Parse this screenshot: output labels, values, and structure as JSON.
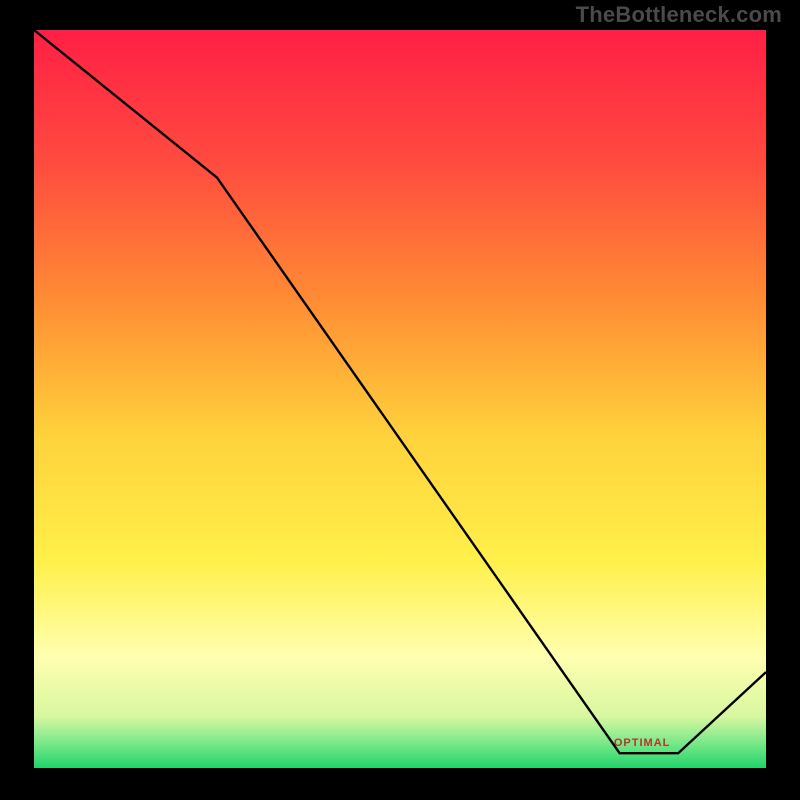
{
  "watermark": "TheBottleneck.com",
  "min_marker_label": "OPTIMAL",
  "chart_data": {
    "type": "line",
    "title": "",
    "xlabel": "",
    "ylabel": "",
    "xlim": [
      0,
      100
    ],
    "ylim": [
      0,
      100
    ],
    "x": [
      0,
      25,
      80,
      88,
      100
    ],
    "values": [
      100,
      80,
      2,
      2,
      13
    ],
    "notes": "Curve read from pixels: starts at top-left, shallow drop to x≈25, steep linear drop to a flat minimum around x≈80–88 near y≈0, then rises toward the right edge. Background is a vertical gradient (red→orange→yellow→pale-yellow→green) representing a heat scale; no axis ticks or labels are visible.",
    "gradient_stops": [
      {
        "offset": 0.0,
        "color": "#ff1f45"
      },
      {
        "offset": 0.18,
        "color": "#ff4b3f"
      },
      {
        "offset": 0.36,
        "color": "#ff8a34"
      },
      {
        "offset": 0.55,
        "color": "#ffd23b"
      },
      {
        "offset": 0.72,
        "color": "#fff04a"
      },
      {
        "offset": 0.85,
        "color": "#ffffb0"
      },
      {
        "offset": 0.93,
        "color": "#d8f7a0"
      },
      {
        "offset": 0.965,
        "color": "#7ce98a"
      },
      {
        "offset": 1.0,
        "color": "#22d36b"
      }
    ],
    "min_marker_x": 84
  }
}
